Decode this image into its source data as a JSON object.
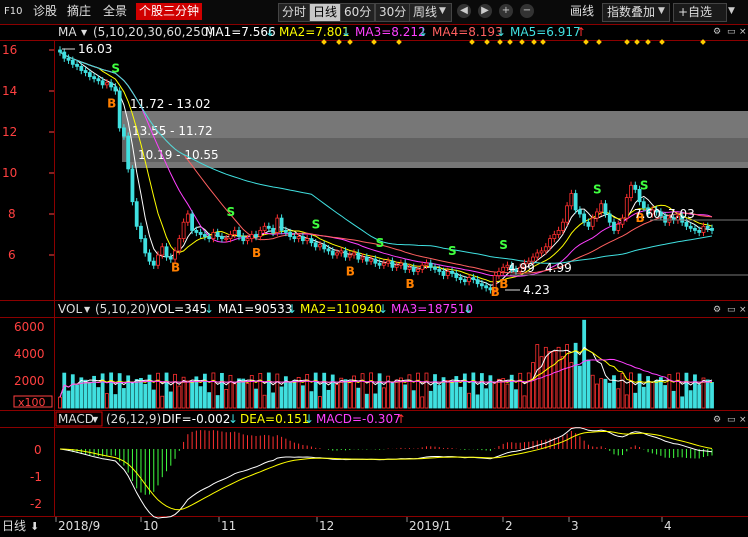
{
  "toolbar": {
    "left_tabs": [
      "F10",
      "诊股",
      "摘庄",
      "全景",
      "个股三分钟"
    ],
    "periods": [
      "分时",
      "日线",
      "60分",
      "30分",
      "周线"
    ],
    "active_period": "日线",
    "right_buttons": [
      "画线",
      "指数叠加",
      "+自选"
    ]
  },
  "colors": {
    "ma1": "#ffffff",
    "ma2": "#ffff00",
    "ma3": "#ff40ff",
    "ma4": "#ff6060",
    "ma5": "#40e0e0",
    "up": "#ff3030",
    "down": "#40e0e0",
    "dif": "#ffffff",
    "dea": "#ffff00",
    "accent": "#d00000"
  },
  "main_panel": {
    "indicator": "MA",
    "params": "(5,10,20,30,60,250)",
    "legend": [
      {
        "label": "MA1=7.566",
        "arrow": "↓",
        "color": "#ffffff"
      },
      {
        "label": "MA2=7.801",
        "arrow": "↓",
        "color": "#ffff00"
      },
      {
        "label": "MA3=8.212",
        "arrow": "↓",
        "color": "#ff40ff"
      },
      {
        "label": "MA4=8.193",
        "arrow": "↓",
        "color": "#ff6060"
      },
      {
        "label": "MA5=6.917",
        "arrow": "↑",
        "color": "#40e0e0"
      }
    ],
    "y_ticks": [
      "16",
      "14",
      "12",
      "10",
      "8",
      "6"
    ],
    "annotations": {
      "high": "16.03",
      "low": "4.23",
      "zone1": "11.72 - 13.02",
      "zone2": "13.55 - 11.72",
      "zone3": "10.19 - 10.55",
      "mid1": "4.99",
      "mid2": "4.99",
      "right1": "7.60",
      "right2": "7.03"
    },
    "signal_labels": {
      "buy": "B",
      "sell": "S"
    }
  },
  "vol_panel": {
    "indicator": "VOL",
    "params": "(5,10,20)",
    "legend": [
      {
        "label": "VOL=345",
        "arrow": "↓",
        "color": "#ffffff"
      },
      {
        "label": "MA1=90533",
        "arrow": "↓",
        "color": "#ffffff"
      },
      {
        "label": "MA2=110940",
        "arrow": "↓",
        "color": "#ffff00"
      },
      {
        "label": "MA3=187510",
        "arrow": "↓",
        "color": "#ff40ff"
      }
    ],
    "y_ticks": [
      "6000",
      "4000",
      "2000"
    ],
    "unit": "x100"
  },
  "macd_panel": {
    "indicator": "MACD",
    "params": "(26,12,9)",
    "legend": [
      {
        "label": "DIF=-0.002",
        "arrow": "↓",
        "color": "#ffffff"
      },
      {
        "label": "DEA=0.151",
        "arrow": "↓",
        "color": "#ffff00"
      },
      {
        "label": "MACD=-0.307",
        "arrow": "↑",
        "color": "#ff40ff"
      }
    ],
    "y_ticks": [
      "0",
      "-1",
      "-2"
    ]
  },
  "bottom_bar": {
    "mode": "日线",
    "months": [
      "2018/9",
      "10",
      "11",
      "12",
      "2019/1",
      "2",
      "3",
      "4"
    ]
  },
  "chart_data": {
    "type": "candlestick",
    "title": "",
    "period": "daily",
    "x_range": [
      "2018/9",
      "2019/4"
    ],
    "ylim": [
      4,
      16.5
    ],
    "close": [
      15.9,
      15.6,
      15.5,
      15.3,
      15.2,
      15.0,
      14.9,
      14.7,
      14.6,
      14.5,
      14.3,
      14.4,
      14.2,
      14.0,
      12.2,
      11.8,
      10.2,
      8.6,
      7.4,
      6.8,
      6.1,
      5.7,
      5.5,
      6.0,
      6.4,
      5.9,
      5.8,
      6.2,
      6.8,
      7.6,
      8.0,
      7.2,
      7.1,
      7.0,
      6.9,
      6.8,
      7.1,
      6.9,
      6.8,
      6.8,
      7.0,
      7.2,
      6.9,
      6.7,
      6.8,
      7.0,
      6.9,
      7.2,
      7.4,
      7.3,
      7.1,
      7.8,
      7.2,
      7.1,
      6.9,
      6.8,
      6.9,
      6.7,
      6.8,
      6.6,
      6.4,
      6.5,
      6.3,
      6.2,
      6.0,
      6.1,
      6.2,
      5.9,
      6.0,
      6.1,
      5.8,
      5.9,
      5.7,
      5.8,
      5.6,
      5.5,
      5.6,
      5.7,
      5.4,
      5.5,
      5.6,
      5.3,
      5.4,
      5.2,
      5.3,
      5.5,
      5.6,
      5.4,
      5.3,
      5.2,
      5.0,
      5.2,
      5.1,
      4.9,
      4.8,
      4.7,
      4.9,
      4.8,
      4.6,
      4.5,
      4.4,
      4.3,
      5.0,
      5.2,
      5.4,
      5.5,
      5.3,
      5.2,
      5.4,
      5.6,
      5.7,
      5.9,
      6.1,
      6.2,
      6.4,
      6.8,
      7.0,
      7.2,
      7.6,
      8.4,
      9.0,
      8.2,
      8.0,
      7.6,
      7.4,
      7.8,
      8.1,
      8.5,
      8.0,
      7.6,
      7.2,
      7.5,
      7.8,
      8.8,
      9.4,
      9.2,
      8.6,
      8.3,
      8.0,
      8.2,
      8.1,
      7.9,
      7.6,
      7.8,
      7.7,
      7.9,
      7.6,
      7.4,
      7.3,
      7.2,
      7.1,
      7.4,
      7.3,
      7.2
    ],
    "markers": {
      "high": 16.03,
      "low": 4.23
    },
    "zones": [
      {
        "label": "11.72 - 13.02",
        "low": 11.72,
        "high": 13.02
      },
      {
        "label": "13.55 - 11.72",
        "low": 10.55,
        "high": 11.72
      },
      {
        "label": "10.19 - 10.55",
        "low": 10.19,
        "high": 10.55
      }
    ],
    "volume_ylim": [
      0,
      7000
    ],
    "macd_ylim": [
      -2.6,
      0.6
    ],
    "ma_latest": {
      "MA1": 7.566,
      "MA2": 7.801,
      "MA3": 8.212,
      "MA4": 8.193,
      "MA5": 6.917
    },
    "vol_latest": {
      "VOL": 345,
      "MA1": 90533,
      "MA2": 110940,
      "MA3": 187510
    },
    "macd_latest": {
      "DIF": -0.002,
      "DEA": 0.151,
      "MACD": -0.307
    }
  }
}
